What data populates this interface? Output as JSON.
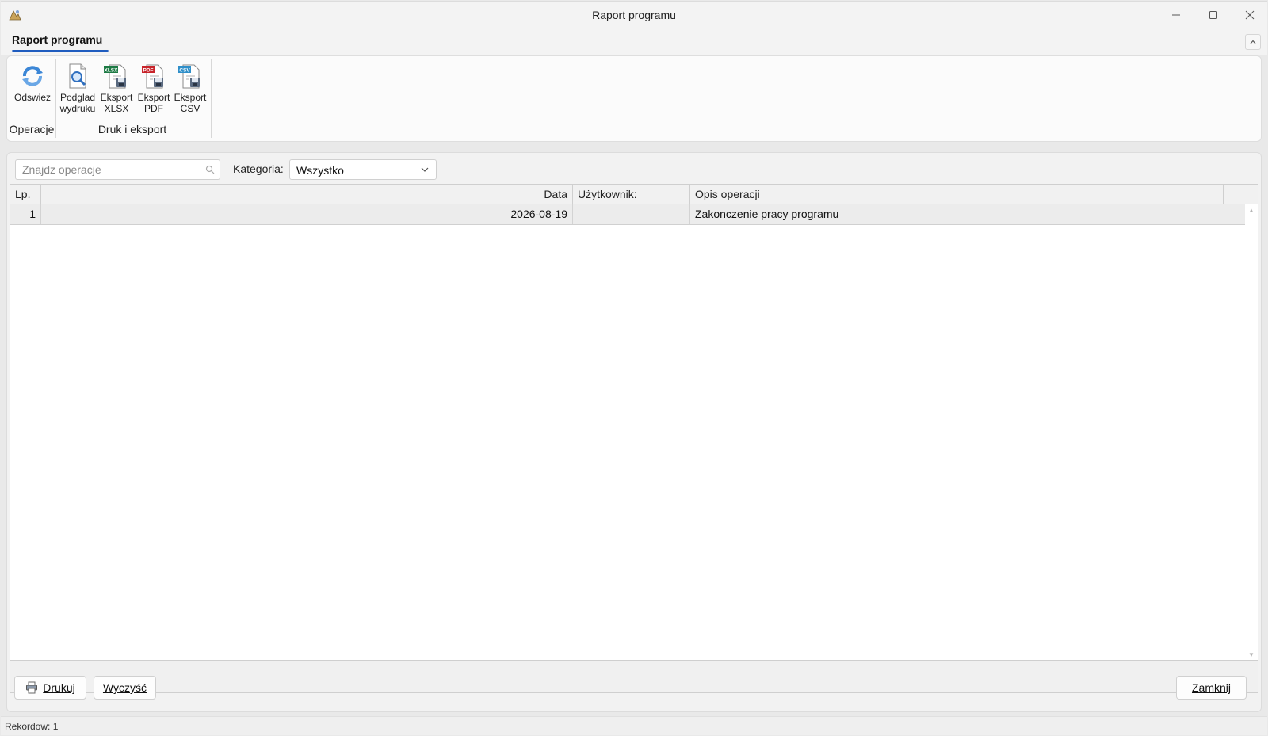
{
  "window": {
    "title": "Raport programu",
    "minimize_glyph": "—",
    "maximize_glyph": "☐",
    "close_glyph": "✕"
  },
  "ribbon": {
    "tab_label": "Raport programu",
    "collapse_glyph": "⌃",
    "groups": {
      "operations": {
        "label": "Operacje",
        "refresh_label": "Odswiez"
      },
      "print_export": {
        "label": "Druk i eksport",
        "preview_line1": "Podglad",
        "preview_line2": "wydruku",
        "xlsx_line1": "Eksport",
        "xlsx_line2": "XLSX",
        "pdf_line1": "Eksport",
        "pdf_line2": "PDF",
        "csv_line1": "Eksport",
        "csv_line2": "CSV",
        "xlsx_badge": "XLSX",
        "pdf_badge": "PDF",
        "csv_badge": "CSV"
      }
    }
  },
  "filters": {
    "search_placeholder": "Znajdz operacje",
    "search_value": "",
    "category_label": "Kategoria:",
    "category_value": "Wszystko"
  },
  "grid": {
    "columns": [
      "Lp.",
      "Data",
      "Użytkownik:",
      "Opis operacji"
    ],
    "rows": [
      {
        "lp": "1",
        "data": "2026-08-19",
        "user": "",
        "desc": "Zakonczenie pracy programu"
      }
    ]
  },
  "buttons": {
    "print_label": "Drukuj",
    "clear_label": "Wyczyść",
    "close_label": "Zamknij"
  },
  "status": {
    "records": "Rekordow: 1"
  },
  "colors": {
    "accent": "#1f5cbf",
    "xlsx": "#1d7a44",
    "pdf": "#c8242b",
    "csv": "#2f8fc9"
  }
}
